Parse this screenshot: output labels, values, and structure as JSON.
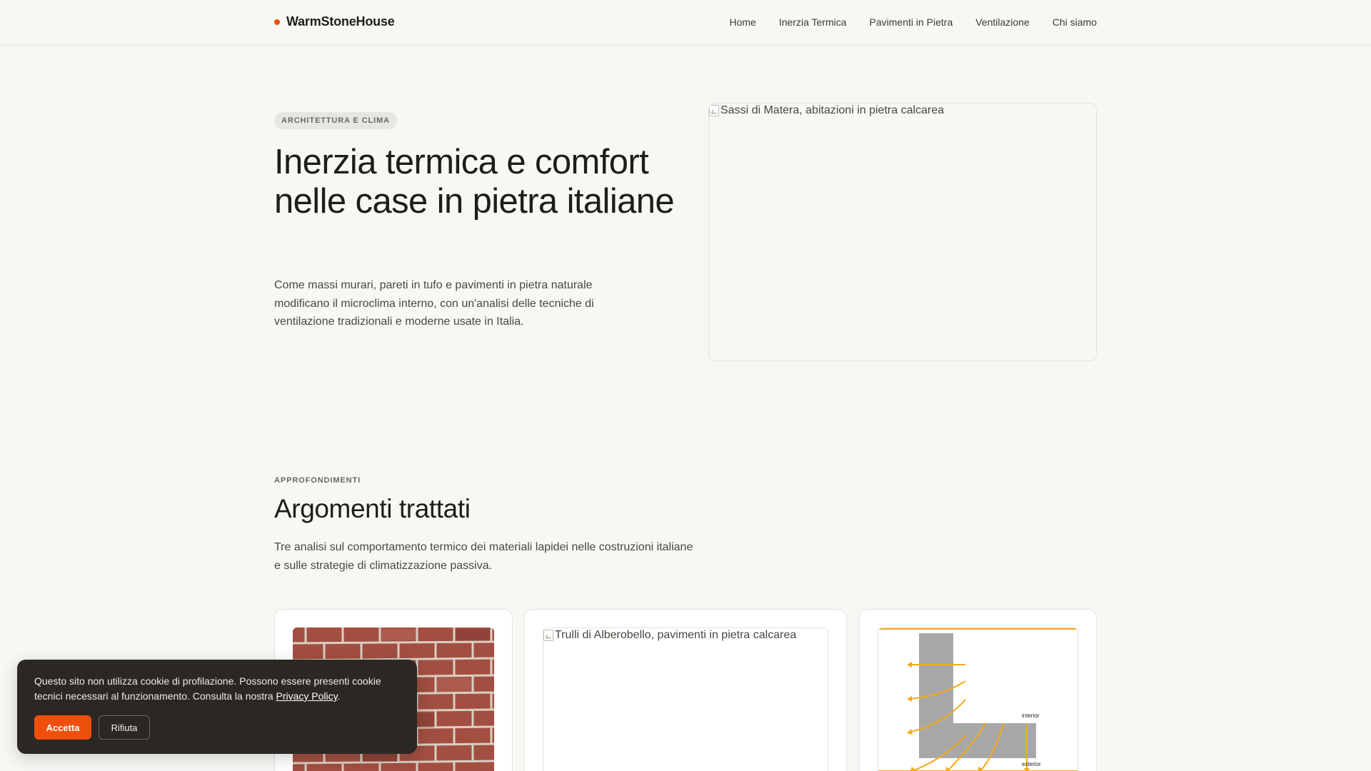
{
  "header": {
    "brand": "WarmStoneHouse",
    "nav": [
      {
        "label": "Home"
      },
      {
        "label": "Inerzia Termica"
      },
      {
        "label": "Pavimenti in Pietra"
      },
      {
        "label": "Ventilazione"
      },
      {
        "label": "Chi siamo"
      }
    ]
  },
  "hero": {
    "eyebrow": "ARCHITETTURA E CLIMA",
    "title": "Inerzia termica e comfort nelle case in pietra italiane",
    "description": "Come massi murari, pareti in tufo e pavimenti in pietra naturale modificano il microclima interno, con un'analisi delle tecniche di ventilazione tradizionali e moderne usate in Italia.",
    "image_alt": "Sassi di Matera, abitazioni in pietra calcarea"
  },
  "topics": {
    "eyebrow": "APPROFONDIMENTI",
    "title": "Argomenti trattati",
    "description": "Tre analisi sul comportamento termico dei materiali lapidei nelle costruzioni italiane e sulle strategie di climatizzazione passiva.",
    "cards": [
      {
        "image_alt": ""
      },
      {
        "image_alt": "Trulli di Alberobello, pavimenti in pietra calcarea"
      },
      {
        "image_alt": "",
        "diagram_labels": {
          "interior": "interior",
          "exterior": "exterior"
        }
      }
    ]
  },
  "cookie": {
    "text": "Questo sito non utilizza cookie di profilazione. Possono essere presenti cookie tecnici necessari al funzionamento. Consulta la nostra ",
    "link": "Privacy Policy",
    "suffix": ".",
    "accept": "Accetta",
    "reject": "Rifiuta"
  },
  "colors": {
    "accent": "#f04e0d",
    "background": "#f7f7f4",
    "banner": "#2b2824",
    "diagram_arrow": "#f5a91b",
    "diagram_wall": "#a8a8a8"
  }
}
